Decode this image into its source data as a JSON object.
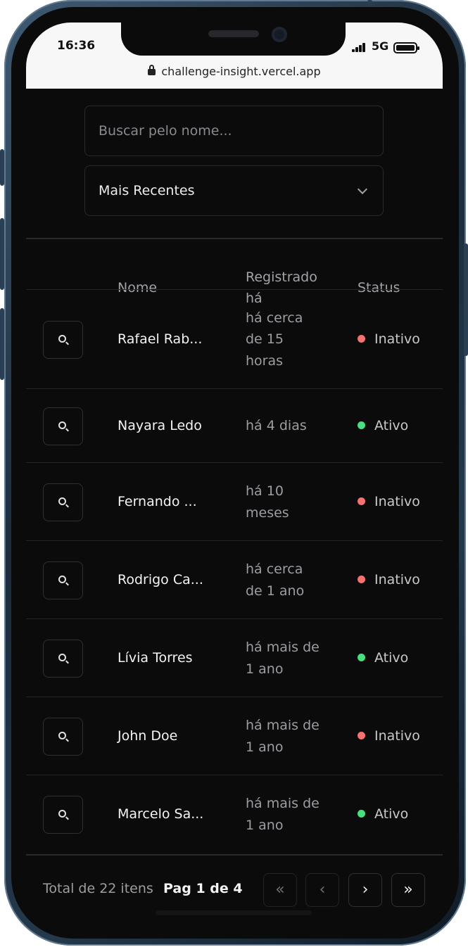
{
  "status_bar": {
    "time": "16:36",
    "network": "5G"
  },
  "browser": {
    "url": "challenge-insight.vercel.app"
  },
  "search": {
    "placeholder": "Buscar pelo nome...",
    "value": ""
  },
  "sort": {
    "selected": "Mais Recentes"
  },
  "table": {
    "headers": {
      "name": "Nome",
      "registered_line1": "Registrado",
      "registered_line2": "há",
      "status": "Status"
    },
    "rows": [
      {
        "name": "Rafael Rab...",
        "registered": [
          "há cerca",
          "de 15",
          "horas"
        ],
        "status": "Inativo",
        "active": false
      },
      {
        "name": "Nayara Ledo",
        "registered": [
          "há 4 dias"
        ],
        "status": "Ativo",
        "active": true
      },
      {
        "name": "Fernando ...",
        "registered": [
          "há 10",
          "meses"
        ],
        "status": "Inativo",
        "active": false
      },
      {
        "name": "Rodrigo Ca...",
        "registered": [
          "há cerca",
          "de 1 ano"
        ],
        "status": "Inativo",
        "active": false
      },
      {
        "name": "Lívia Torres",
        "registered": [
          "há mais de",
          "1 ano"
        ],
        "status": "Ativo",
        "active": true
      },
      {
        "name": "John Doe",
        "registered": [
          "há mais de",
          "1 ano"
        ],
        "status": "Inativo",
        "active": false
      },
      {
        "name": "Marcelo Sa...",
        "registered": [
          "há mais de",
          "1 ano"
        ],
        "status": "Ativo",
        "active": true
      }
    ]
  },
  "pagination": {
    "total": "Total de 22 itens",
    "page": "Pag 1 de 4",
    "first": "«",
    "prev": "‹",
    "next": "›",
    "last": "»"
  },
  "colors": {
    "active": "#4ade80",
    "inactive": "#f87171",
    "background": "#0b0b0c"
  }
}
